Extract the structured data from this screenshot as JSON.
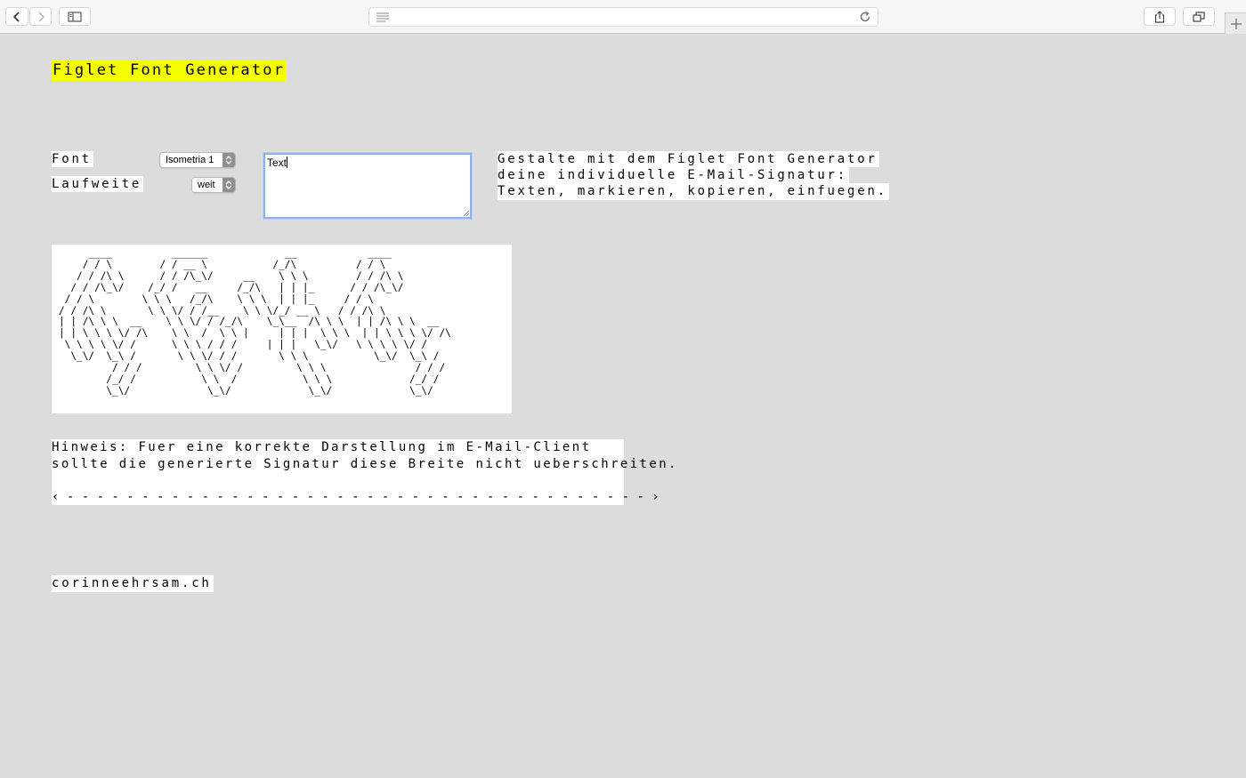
{
  "page": {
    "title": "Figlet Font Generator",
    "title_highlight_color": "#f5ff00",
    "background_color": "#dcdcdc"
  },
  "controls": {
    "font_label": "Font",
    "font_value": "Isometria 1",
    "spacing_label": "Laufweite",
    "spacing_value": "weit",
    "text_value": "Text"
  },
  "description": {
    "line1": "Gestalte mit dem Figlet Font Generator",
    "line2": "deine individuelle E-Mail-Signatur:",
    "line3": "Texten, markieren, kopieren, einfuegen."
  },
  "ascii_output": "     ____          ______             __            ____ \n    / / \\        / / __ \\           /_/\\          / / \\\n   / / /\\ \\      / / /\\_\\/     __    \\ \\ \\        / / /\\ \\\n  / / /\\_\\/    /_/ /   __     /_/\\   | | |_      / / /\\_\\/\n / / \\        \\ \\ \\   /_/\\    \\ \\ \\  | | |_     / / \\\n/ / /\\ \\       \\ \\ \\/ / /__    \\ \\ \\/_/ __ \\   / / /\\ \\\n| | /\\ \\ \\  __    \\ \\ \\/ / /_/\\    \\_\\__  /\\ \\ \\  | | /\\ \\ \\  __\n| | \\ \\ \\ \\/ /\\    \\ \\  /  \\ \\ |     | | |  \\ \\ \\  | | \\ \\ \\ \\/ /\\\n \\ \\ \\ \\ \\/ /      \\ \\ \\ / / /     | | |   \\_\\/   \\ \\ \\ \\ \\/ /\n  \\_\\/  \\_\\ /       \\ \\ \\/ / /       \\ \\ \\           \\_\\/  \\_\\ /\n         / / /         \\ \\ \\/ /         \\ \\ \\               / / /\n        /_/ /           \\ \\  /           \\ \\ \\             /_/ /\n        \\_\\/             \\_\\/             \\_\\/             \\_\\/",
  "hint": {
    "line1": "Hinweis: Fuer eine korrekte Darstellung im E-Mail-Client",
    "line2": "sollte die generierte Signatur diese Breite nicht ueberschreiten.",
    "ruler": "‹ - - - - - - - - - - - - - - - - - - - - - - - - - - - - - - - - - - - - - - - ›"
  },
  "footer": {
    "link": "corinneehrsam.ch"
  },
  "browser": {
    "icons": [
      "back-icon",
      "forward-icon",
      "sidebar-icon",
      "reader-icon",
      "reload-icon",
      "share-icon",
      "tabs-icon",
      "new-tab-icon"
    ]
  }
}
